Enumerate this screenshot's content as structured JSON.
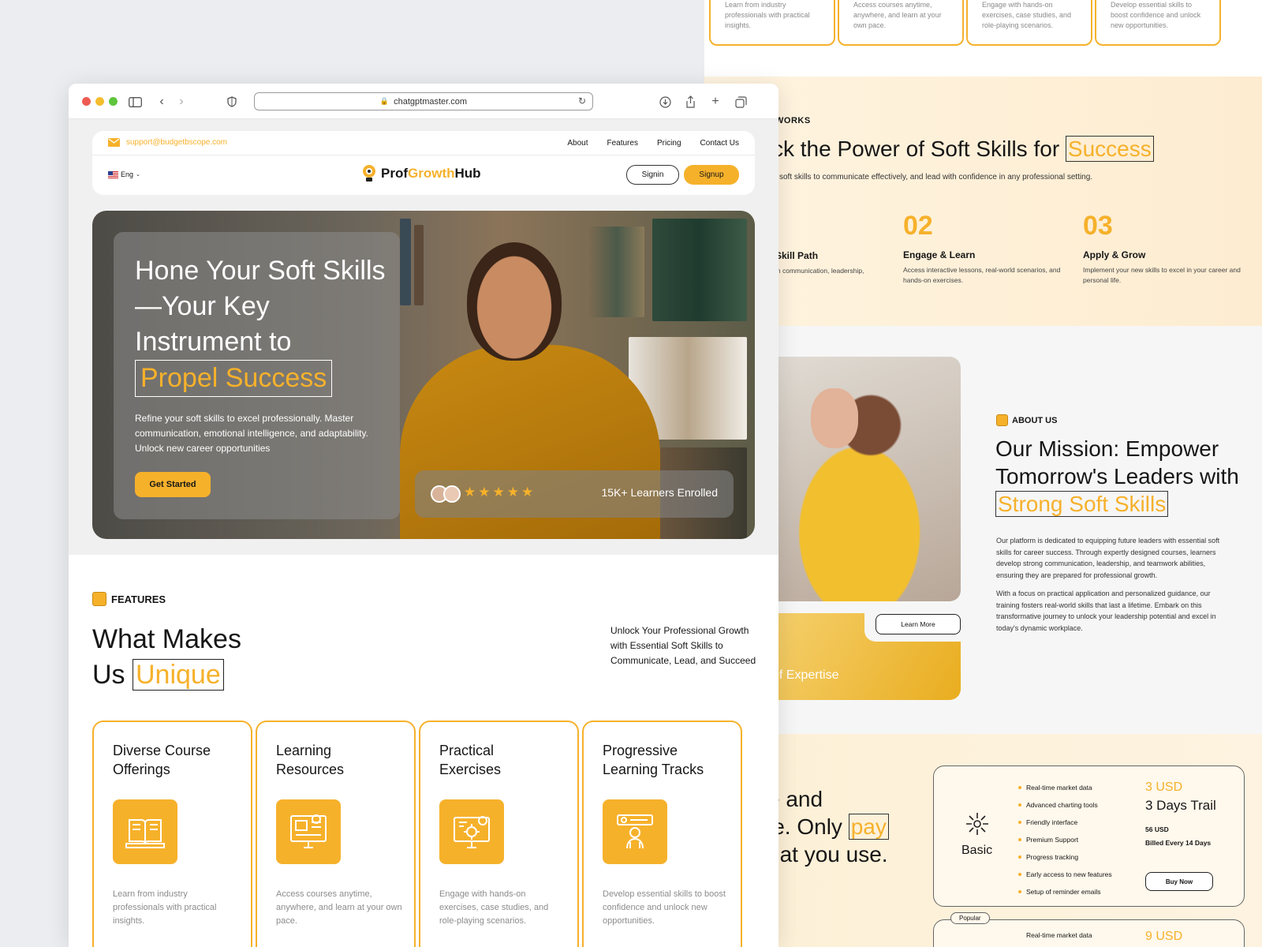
{
  "back": {
    "top_cards": [
      "Learn from industry professionals with practical insights.",
      "Access courses anytime, anywhere, and learn at your own pace.",
      "Engage with hands-on exercises, case studies, and role-playing scenarios.",
      "Develop essential skills to boost confidence and unlock new opportunities."
    ],
    "how": {
      "tag": "WORKS",
      "title": "ck the Power of Soft Skills for ",
      "title_highlight": "Success",
      "subtitle": "soft skills to communicate effectively, and lead with confidence in any professional setting.",
      "steps": [
        {
          "num": "",
          "title": "Skill Path",
          "desc": "in communication, leadership,"
        },
        {
          "num": "02",
          "title": "Engage & Learn",
          "desc": "Access interactive lessons, real-world scenarios, and hands-on exercises."
        },
        {
          "num": "03",
          "title": "Apply & Grow",
          "desc": "Implement your new skills to excel in your career and personal life."
        }
      ]
    },
    "about": {
      "tag": "ABOUT US",
      "title": "Our Mission: Empower Tomorrow's Leaders with ",
      "title_highlight": "Strong Soft Skills",
      "p1": "Our platform is dedicated to equipping future leaders with essential soft skills for career success. Through expertly designed courses, learners develop strong communication, leadership, and teamwork abilities, ensuring they are prepared for professional growth.",
      "p2": "With a focus on practical application and personalized guidance, our training fosters real-world skills that last a lifetime. Embark on this transformative journey to unlock your leadership potential and excel in today's dynamic workplace.",
      "learn_more": "Learn More",
      "expertise": "of Expertise"
    },
    "pricing": {
      "title_l1": "e and",
      "title_l2": "le. Only ",
      "title_highlight": "pay",
      "title_l3": "hat you use.",
      "features": [
        "Real-time market data",
        "Advanced charting tools",
        "Friendly interface",
        "Premium Support",
        "Progress tracking",
        "Early access to new features",
        "Setup of reminder emails"
      ],
      "plan_name": "Basic",
      "price": "3 USD",
      "trial": "3 Days Trail",
      "usd": "56 USD",
      "billed": "Billed Every 14 Days",
      "buy": "Buy Now",
      "popular": "Popular",
      "card2_feature": "Real-time market data",
      "card2_price": "9 USD"
    }
  },
  "browser": {
    "url": "chatgptmaster.com"
  },
  "nav": {
    "email": "support@budgetbscope.com",
    "links": [
      "About",
      "Features",
      "Pricing",
      "Contact Us"
    ],
    "lang": "Eng",
    "logo_a": "Prof",
    "logo_b": "Growth",
    "logo_c": "Hub",
    "signin": "Signin",
    "signup": "Signup"
  },
  "hero": {
    "title": "Hone Your Soft Skills—Your Key Instrument to",
    "title_highlight": "Propel Success",
    "desc": "Refine your soft skills to excel professionally. Master communication, emotional intelligence, and adaptability. Unlock new career opportunities",
    "cta": "Get Started",
    "rating_stars": 5,
    "enrolled": "15K+ Learners Enrolled"
  },
  "features": {
    "tag": "FEATURES",
    "title_a": "What Makes",
    "title_b": "Us ",
    "title_highlight": "Unique",
    "desc": "Unlock Your Professional Growth with Essential Soft Skills to Communicate, Lead, and Succeed",
    "cards": [
      {
        "title": "Diverse Course Offerings",
        "desc": "Learn from industry professionals with practical insights.",
        "icon": "open-book-icon"
      },
      {
        "title": "Learning Resources",
        "desc": "Access courses anytime, anywhere, and learn at your own pace.",
        "icon": "monitor-resources-icon"
      },
      {
        "title": "Practical Exercises",
        "desc": "Engage with hands-on exercises, case studies, and role-playing scenarios.",
        "icon": "gear-exercise-icon"
      },
      {
        "title": "Progressive Learning Tracks",
        "desc": "Develop essential skills to boost confidence and unlock new opportunities.",
        "icon": "person-growth-icon"
      }
    ]
  },
  "colors": {
    "accent": "#f6b12b",
    "text": "#161616"
  }
}
